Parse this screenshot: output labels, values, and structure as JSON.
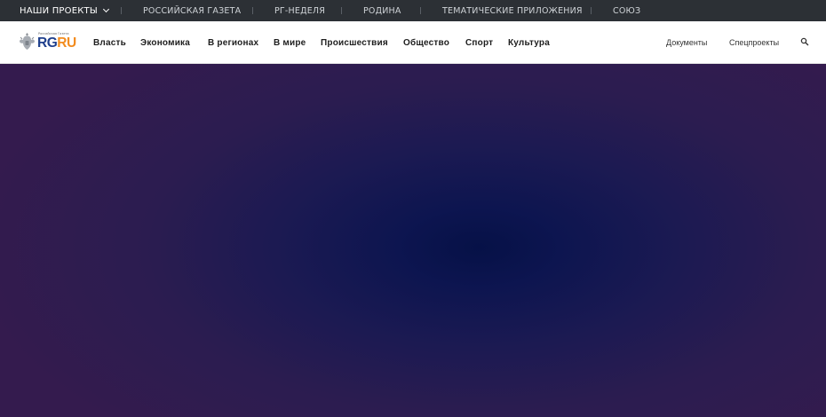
{
  "topbar": {
    "projects_label": "НАШИ ПРОЕКТЫ",
    "links": [
      "РОССИЙСКАЯ ГАЗЕТА",
      "РГ-НЕДЕЛЯ",
      "РОДИНА",
      "ТЕМАТИЧЕСКИЕ ПРИЛОЖЕНИЯ",
      "СОЮЗ"
    ]
  },
  "logo": {
    "tagline": "Российская Газета",
    "brand_rg": "RG",
    "brand_ru": "RU"
  },
  "nav": {
    "items": [
      "Власть",
      "Экономика",
      "В регионах",
      "В мире",
      "Происшествия",
      "Общество",
      "Спорт",
      "Культура"
    ],
    "right": [
      "Документы",
      "Спецпроекты"
    ]
  },
  "colors": {
    "topbar_bg": "#2c3035",
    "brand_blue": "#1f3f8c",
    "brand_orange": "#f28c1f",
    "hero_center": "#061147",
    "hero_edge": "#341b4e"
  },
  "icons": {
    "search": "search-icon",
    "projects_toggle": "chevron-down-icon",
    "emblem": "emblem-icon"
  }
}
